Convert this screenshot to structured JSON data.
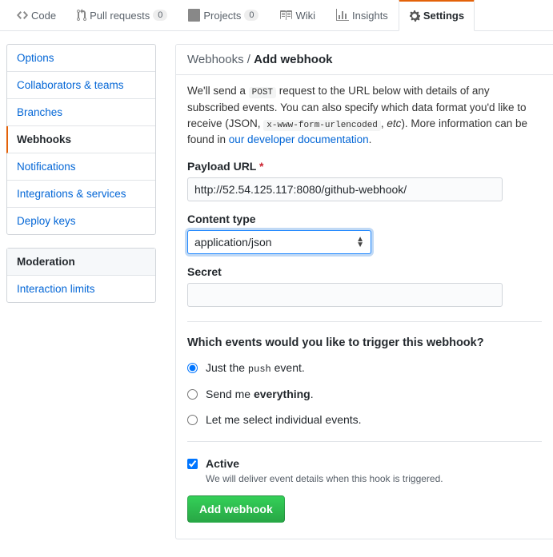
{
  "tabs": {
    "code": "Code",
    "pulls": "Pull requests",
    "pulls_count": "0",
    "projects": "Projects",
    "projects_count": "0",
    "wiki": "Wiki",
    "insights": "Insights",
    "settings": "Settings"
  },
  "sidebar": {
    "options": "Options",
    "collaborators": "Collaborators & teams",
    "branches": "Branches",
    "webhooks": "Webhooks",
    "notifications": "Notifications",
    "integrations": "Integrations & services",
    "deploykeys": "Deploy keys",
    "moderation_heading": "Moderation",
    "interaction": "Interaction limits"
  },
  "breadcrumb": {
    "parent": "Webhooks",
    "sep": " / ",
    "current": "Add webhook"
  },
  "intro": {
    "t1": "We'll send a ",
    "post": "POST",
    "t2": " request to the URL below with details of any subscribed events. You can also specify which data format you'd like to receive (JSON, ",
    "enc": "x-www-form-urlencoded",
    "t3": ", ",
    "etc": "etc",
    "t4": "). More information can be found in ",
    "doclink": "our developer documentation",
    "t5": "."
  },
  "form": {
    "payload_label": "Payload URL",
    "payload_value": "http://52.54.125.117:8080/github-webhook/",
    "content_type_label": "Content type",
    "content_type_value": "application/json",
    "secret_label": "Secret"
  },
  "events": {
    "title": "Which events would you like to trigger this webhook?",
    "push_pre": "Just the ",
    "push_code": "push",
    "push_post": " event.",
    "all_pre": "Send me ",
    "all_strong": "everything",
    "all_post": ".",
    "individual": "Let me select individual events."
  },
  "active": {
    "label": "Active",
    "note": "We will deliver event details when this hook is triggered."
  },
  "submit": "Add webhook"
}
